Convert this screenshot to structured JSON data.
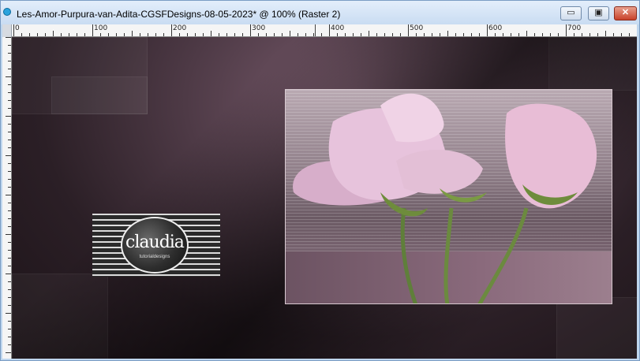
{
  "window": {
    "title": "Les-Amor-Purpura-van-Adita-CGSFDesigns-08-05-2023* @ 100% (Raster 2)",
    "buttons": {
      "minimize": "▭",
      "restore": "▣",
      "close": "✕"
    }
  },
  "ruler": {
    "labels": [
      "0",
      "100",
      "200",
      "300",
      "400",
      "500",
      "600",
      "700"
    ]
  },
  "icons": {
    "app": "app-icon",
    "minimize": "minimize-icon",
    "restore": "restore-icon",
    "close": "close-icon"
  },
  "canvas": {
    "logo_text": "claudia",
    "logo_subtext": "tutorialdesigns"
  },
  "colors": {
    "canvas_background": "#3a2a33",
    "window_frame": "#bfd6ee",
    "close_button": "#c8412a"
  }
}
